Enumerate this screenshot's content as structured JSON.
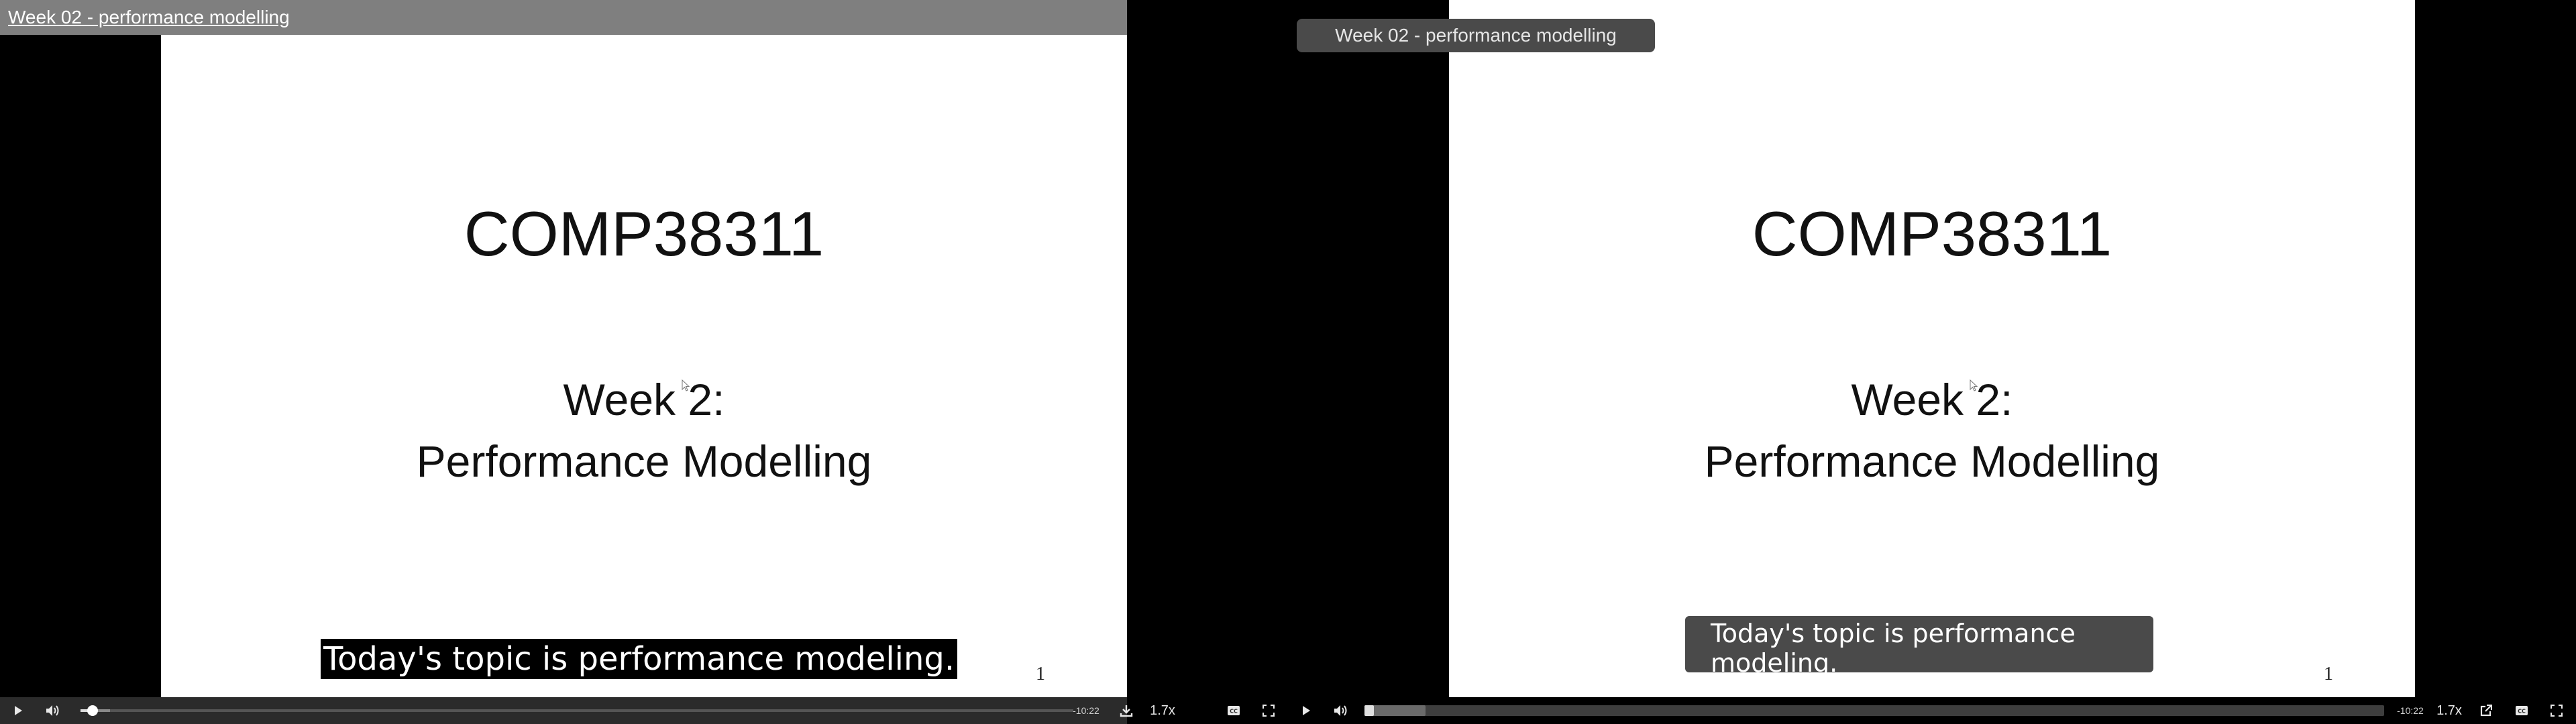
{
  "video_title": "Week 02 - performance modelling",
  "slide": {
    "title": "COMP38311",
    "subtitle_line1": "Week 2:",
    "subtitle_line2": "Performance Modelling",
    "page_number": "1"
  },
  "caption": {
    "left": "Today's topic is performance modeling.",
    "right": "Today's topic is performance modeling."
  },
  "left_controls": {
    "play_icon": "play-icon",
    "volume_icon": "volume-icon",
    "remaining_time": "-10:22",
    "download_icon": "download-icon",
    "speed": "1.7x",
    "captions_icon": "captions-icon",
    "fullscreen_icon": "fullscreen-icon",
    "progress_fraction": 0.012,
    "buffered_fraction": 0.03
  },
  "right_controls": {
    "play_icon": "play-icon",
    "volume_icon": "volume-icon",
    "remaining_time": "-10:22",
    "speed": "1.7x",
    "popout_icon": "popout-icon",
    "captions_icon": "captions-icon",
    "fullscreen_icon": "fullscreen-icon",
    "progress_fraction": 0.005,
    "buffered_fraction": 0.06
  },
  "colors": {
    "control_bar": "#2b2b2b",
    "title_bar": "#7f7f7f",
    "pill": "#4a4a4a"
  }
}
